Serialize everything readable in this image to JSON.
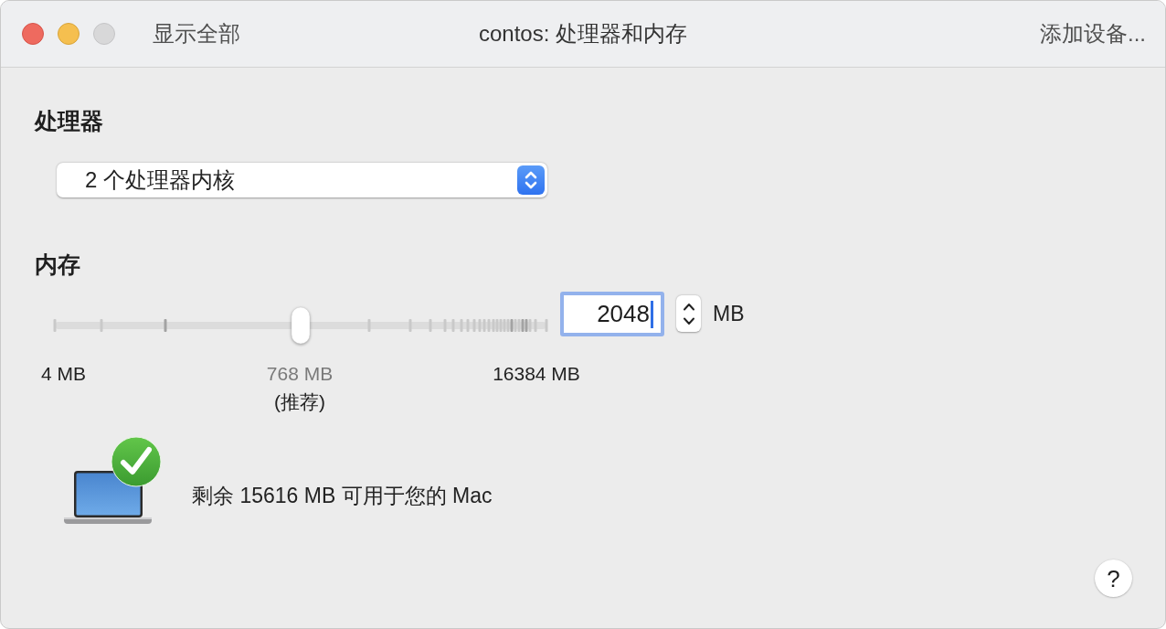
{
  "window": {
    "title": "contos: 处理器和内存",
    "controls": [
      {
        "kind": "close",
        "disabled": false
      },
      {
        "kind": "minimize",
        "disabled": false
      },
      {
        "kind": "zoom",
        "disabled": true
      }
    ]
  },
  "toolbar": {
    "show_all": "显示全部",
    "add_device": "添加设备..."
  },
  "processor": {
    "heading": "处理器",
    "popup": {
      "value": "2 个处理器内核"
    }
  },
  "memory": {
    "heading": "内存",
    "slider": {
      "level": 0.5,
      "labels": [
        {
          "kind": "min",
          "text": "4 MB"
        },
        {
          "kind": "recommended",
          "text": "768 MB",
          "note": "(推荐)"
        },
        {
          "kind": "max",
          "text": "16384 MB"
        }
      ]
    },
    "field": {
      "value": "2048",
      "focused": true
    },
    "unit": "MB"
  },
  "status": {
    "text": "剩余 15616 MB 可用于您的 Mac",
    "ok": true
  },
  "help": {
    "label": "?"
  }
}
